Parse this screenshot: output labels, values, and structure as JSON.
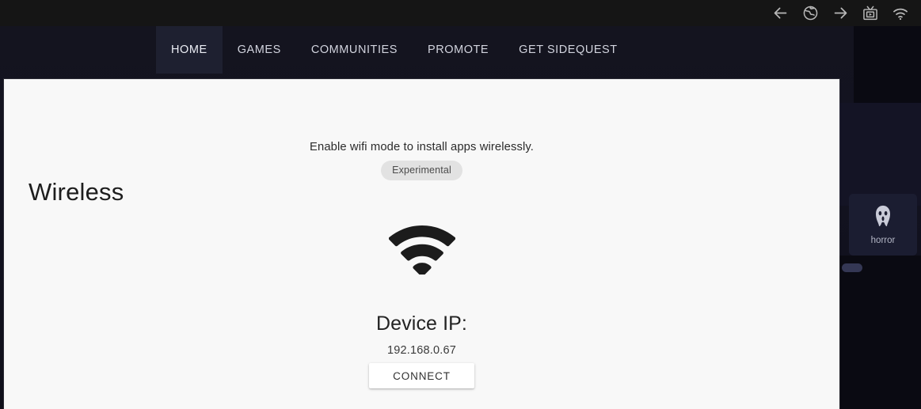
{
  "topbar": {
    "icons": [
      {
        "name": "back-arrow-icon",
        "label": "Back"
      },
      {
        "name": "globe-icon",
        "label": "Browser"
      },
      {
        "name": "forward-arrow-icon",
        "label": "Forward"
      },
      {
        "name": "cast-tv-icon",
        "label": "Cast"
      },
      {
        "name": "wifi-status-icon",
        "label": "Wi-Fi"
      }
    ]
  },
  "nav": {
    "items": [
      {
        "label": "HOME",
        "active": true
      },
      {
        "label": "GAMES",
        "active": false
      },
      {
        "label": "COMMUNITIES",
        "active": false
      },
      {
        "label": "PROMOTE",
        "active": false
      },
      {
        "label": "GET SIDEQUEST",
        "active": false
      }
    ]
  },
  "background": {
    "category_tile": {
      "label": "horror",
      "icon": "ghost-mask-icon"
    }
  },
  "modal": {
    "title": "Wireless",
    "description": "Enable wifi mode to install apps wirelessly.",
    "badge": "Experimental",
    "wifi_icon": "wifi-icon",
    "device_ip_label": "Device IP:",
    "device_ip_value": "192.168.0.67",
    "connect_label": "CONNECT"
  },
  "colors": {
    "topbar_bg": "#151515",
    "page_bg": "#14141f",
    "nav_active_bg": "#1e2030",
    "panel_bg": "#f8f8f8",
    "badge_bg": "#e2e2e2",
    "tile_bg": "#1b1d31",
    "text_dark": "#1d1d1d",
    "text_light": "#d2d4de"
  }
}
